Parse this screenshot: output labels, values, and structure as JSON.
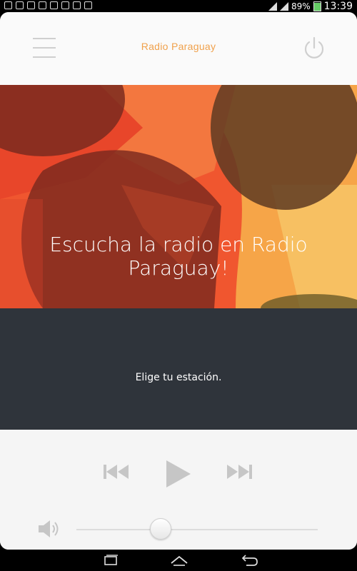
{
  "status_bar": {
    "battery": "89%",
    "time": "13:39",
    "icons": [
      "usb-icon",
      "usb-icon",
      "wifi-icon",
      "sd-card-icon",
      "brush-icon",
      "image-icon",
      "youtube-icon",
      "bag-icon"
    ]
  },
  "header": {
    "title": "Radio Paraguay",
    "menu_icon": "hamburger-menu-icon",
    "power_icon": "power-icon"
  },
  "hero": {
    "text": "Escucha la radio en Radio Paraguay!"
  },
  "station": {
    "text": "Elige tu estación."
  },
  "controls": {
    "prev_icon": "skip-previous-icon",
    "play_icon": "play-icon",
    "next_icon": "skip-next-icon",
    "volume_icon": "speaker-icon",
    "volume_level": 0.35
  },
  "colors": {
    "accent": "#f0a14c",
    "hero_bg": "#f26a3c",
    "station_bg": "#2f343b",
    "control_icon": "#c6c6c6"
  }
}
